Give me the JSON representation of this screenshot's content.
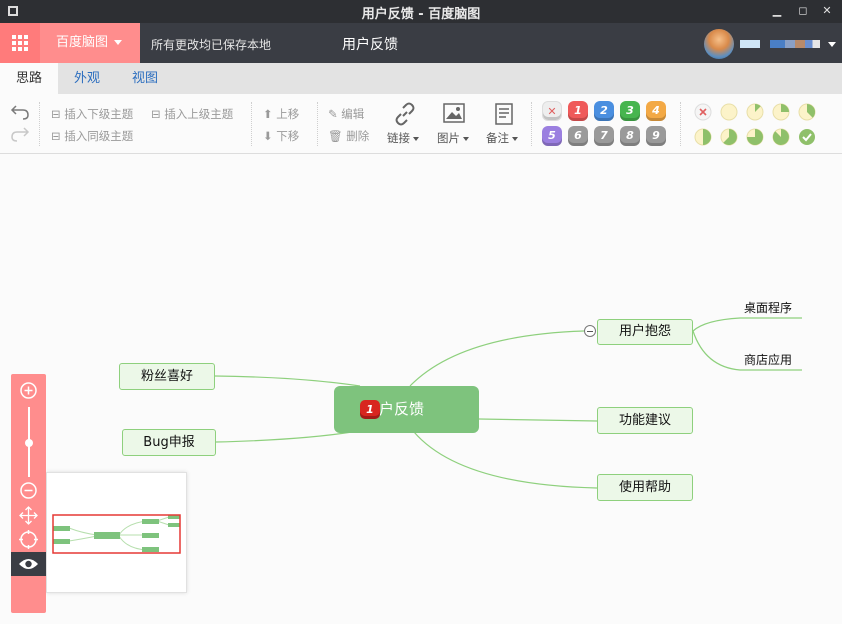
{
  "window": {
    "title": "用户反馈 - 百度脑图"
  },
  "header": {
    "brand": "百度脑图",
    "saved_status": "所有更改均已保存本地",
    "doc_title": "用户反馈"
  },
  "tabs": [
    "思路",
    "外观",
    "视图"
  ],
  "toolbar": {
    "insert_child": "插入下级主题",
    "insert_parent": "插入上级主题",
    "insert_sibling": "插入同级主题",
    "move_up": "上移",
    "move_down": "下移",
    "edit": "编辑",
    "delete": "删除",
    "link": "链接",
    "image": "图片",
    "note": "备注",
    "priorities": [
      "1",
      "2",
      "3",
      "4",
      "5",
      "6",
      "7",
      "8",
      "9"
    ],
    "priority_colors": [
      "#ef5a5a",
      "#4a8fe0",
      "#47b54f",
      "#f3a945",
      "#9b7fe0",
      "#9a9a9a",
      "#9a9a9a",
      "#9a9a9a",
      "#9a9a9a"
    ],
    "progress_levels": [
      "none",
      "0",
      "1/8",
      "2/8",
      "3/8",
      "4/8",
      "5/8",
      "6/8",
      "7/8",
      "done"
    ]
  },
  "mindmap": {
    "root": {
      "label": "用户反馈",
      "priority": "1"
    },
    "nodes": [
      {
        "label": "粉丝喜好"
      },
      {
        "label": "Bug申报"
      },
      {
        "label": "用户抱怨",
        "children": [
          "桌面程序",
          "商店应用"
        ]
      },
      {
        "label": "功能建议"
      },
      {
        "label": "使用帮助"
      }
    ]
  },
  "colors": {
    "accent": "#ff8d8d",
    "node_fill": "#ecf8e8",
    "node_border": "#8ed07d",
    "root_fill": "#7ec37d",
    "line": "#8ed07d"
  }
}
